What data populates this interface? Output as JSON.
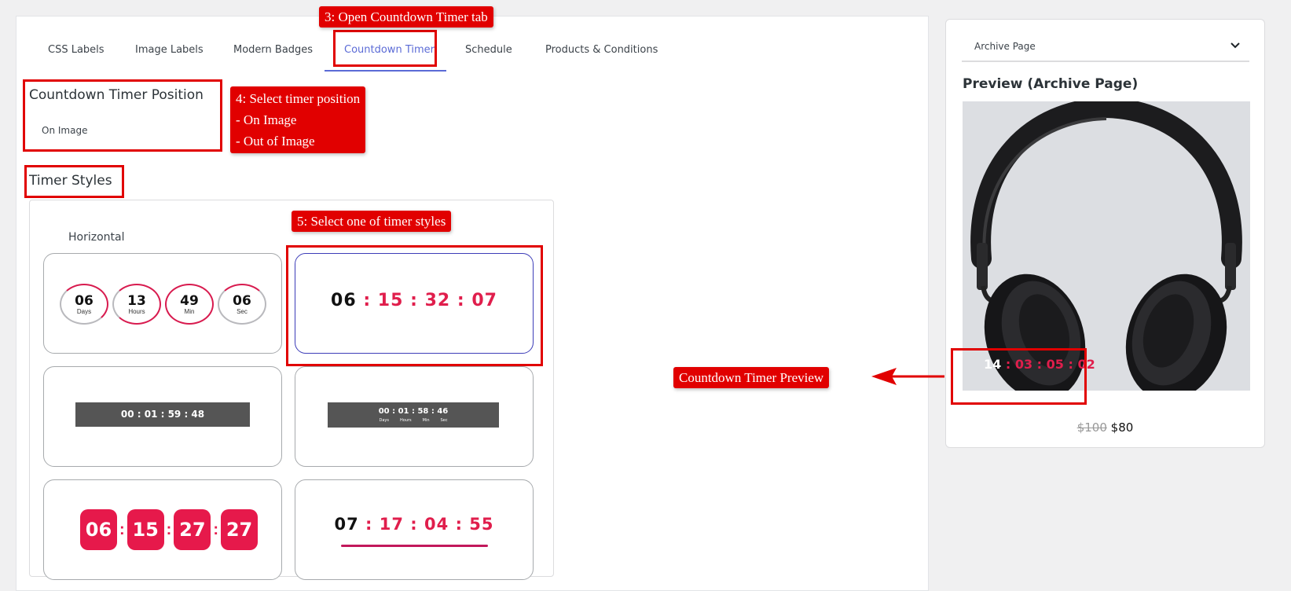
{
  "tabs": [
    {
      "label": "CSS Labels"
    },
    {
      "label": "Image Labels"
    },
    {
      "label": "Modern Badges"
    },
    {
      "label": "Countdown Timer"
    },
    {
      "label": "Schedule"
    },
    {
      "label": "Products & Conditions"
    }
  ],
  "active_tab": "Countdown Timer",
  "accent_color": "#5b6bd6",
  "position": {
    "title": "Countdown Timer Position",
    "value": "On Image"
  },
  "timer_styles": {
    "title": "Timer Styles",
    "group_label": "Horizontal",
    "style1": {
      "circles": [
        {
          "num": "06",
          "unit": "Days"
        },
        {
          "num": "13",
          "unit": "Hours"
        },
        {
          "num": "49",
          "unit": "Min"
        },
        {
          "num": "06",
          "unit": "Sec"
        }
      ]
    },
    "style2": {
      "d": "06",
      "h": "15",
      "m": "32",
      "s": "07",
      "sep": ":"
    },
    "style3": {
      "text": "00 : 01 : 59 : 48"
    },
    "style4": {
      "text": "00 : 01 : 58 : 46",
      "units": [
        "Days",
        "Hours",
        "Min",
        "Sec"
      ]
    },
    "style5": {
      "d": "06",
      "h": "15",
      "m": "27",
      "s": "27",
      "sep": ":"
    },
    "style6": {
      "d": "07",
      "h": "17",
      "m": "04",
      "s": "55",
      "sep": ":"
    }
  },
  "preview": {
    "dropdown_value": "Archive Page",
    "title": "Preview (Archive Page)",
    "timer": {
      "d": "14",
      "h": "03",
      "m": "05",
      "s": "02",
      "sep": ":"
    },
    "old_price": "$100",
    "new_price": "$80"
  },
  "annotations": {
    "step3": "3: Open Countdown Timer tab",
    "step4_line1": "4: Select timer position",
    "step4_line2": "- On Image",
    "step4_line3": "- Out of Image",
    "step5": "5: Select one of timer styles",
    "preview_label": "Countdown Timer Preview",
    "color": "#e10000"
  }
}
